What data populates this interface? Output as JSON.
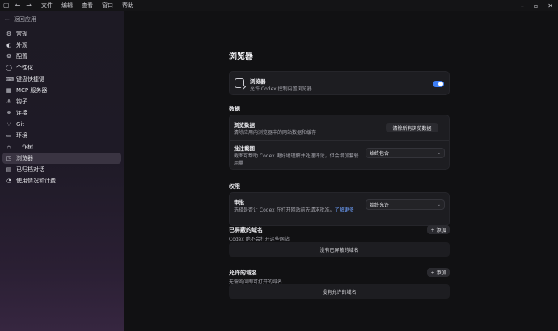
{
  "titlebar": {
    "menus": [
      "文件",
      "编辑",
      "查看",
      "窗口",
      "帮助"
    ]
  },
  "sidebar": {
    "back_label": "返回应用",
    "items": [
      {
        "label": "常规",
        "icon": "gear-icon",
        "glyph": "⚙"
      },
      {
        "label": "外观",
        "icon": "palette-icon",
        "glyph": "◐"
      },
      {
        "label": "配置",
        "icon": "config-icon",
        "glyph": "⚙"
      },
      {
        "label": "个性化",
        "icon": "personalize-icon",
        "glyph": "◯"
      },
      {
        "label": "键盘快捷键",
        "icon": "keyboard-icon",
        "glyph": "⌨"
      },
      {
        "label": "MCP 服务器",
        "icon": "server-icon",
        "glyph": "▦"
      },
      {
        "label": "钩子",
        "icon": "hook-icon",
        "glyph": "⚓"
      },
      {
        "label": "连接",
        "icon": "link-icon",
        "glyph": "⚭"
      },
      {
        "label": "Git",
        "icon": "git-branch-icon",
        "glyph": "⑂"
      },
      {
        "label": "环境",
        "icon": "environment-icon",
        "glyph": "▭"
      },
      {
        "label": "工作树",
        "icon": "worktree-icon",
        "glyph": "⑃"
      },
      {
        "label": "浏览器",
        "icon": "browser-icon",
        "glyph": "◳"
      },
      {
        "label": "已归档对话",
        "icon": "archive-icon",
        "glyph": "▤"
      },
      {
        "label": "使用情况和计费",
        "icon": "usage-icon",
        "glyph": "◔"
      }
    ],
    "active_index": 11
  },
  "main": {
    "title": "浏览器",
    "browser_card": {
      "title": "浏览器",
      "desc": "允许 Codex 控制内置浏览器",
      "toggle_on": true
    },
    "data_section": {
      "title": "数据",
      "browsing_data": {
        "title": "浏览数据",
        "desc": "清除应用内浏览器中的网站数据和缓存",
        "button": "清除所有浏览数据"
      },
      "annot_screenshot": {
        "title": "批注截图",
        "desc_line1": "截图可帮助 Codex 更好地理解并处理评论，但会增加套餐",
        "desc_line2": "用量",
        "select_value": "始终包含"
      }
    },
    "perm_section": {
      "title": "权限",
      "approval": {
        "title": "审批",
        "desc": "选择是否让 Codex 在打开网站前先请求批准。",
        "link": "了解更多",
        "select_value": "始终允许"
      }
    },
    "blocked": {
      "title": "已屏蔽的域名",
      "desc": "Codex 绝不会打开这些网站",
      "add": "+ 添加",
      "empty": "没有已屏蔽的域名"
    },
    "allowed": {
      "title": "允许的域名",
      "desc": "无需询问即可打开的域名",
      "add": "+ 添加",
      "empty": "没有允许的域名"
    }
  },
  "colors": {
    "accent": "#3d7ef5",
    "link": "#6ea1ff"
  }
}
